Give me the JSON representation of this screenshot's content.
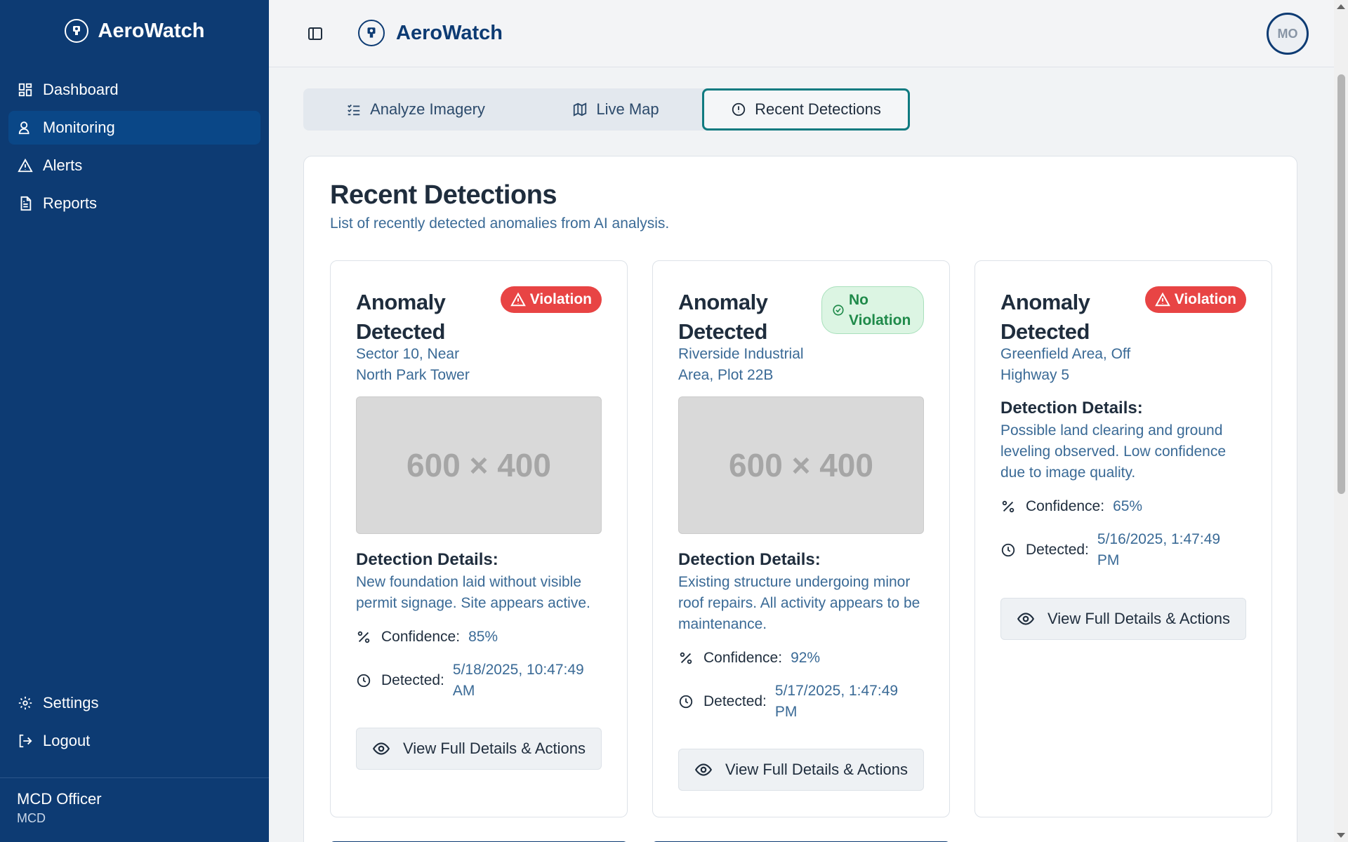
{
  "app": {
    "name": "AeroWatch"
  },
  "sidebar": {
    "brand": "AeroWatch",
    "items": [
      {
        "label": "Dashboard",
        "icon": "grid-icon"
      },
      {
        "label": "Monitoring",
        "icon": "user-search-icon",
        "active": true
      },
      {
        "label": "Alerts",
        "icon": "triangle-alert-icon"
      },
      {
        "label": "Reports",
        "icon": "file-text-icon"
      }
    ],
    "bottom_items": [
      {
        "label": "Settings",
        "icon": "gear-icon"
      },
      {
        "label": "Logout",
        "icon": "logout-icon"
      }
    ],
    "user": {
      "name": "MCD Officer",
      "org": "MCD"
    }
  },
  "header": {
    "brand": "AeroWatch",
    "avatar_initials": "MO"
  },
  "tabs": [
    {
      "label": "Analyze Imagery",
      "icon": "list-check-icon"
    },
    {
      "label": "Live Map",
      "icon": "map-icon"
    },
    {
      "label": "Recent Detections",
      "icon": "alert-circle-icon",
      "active": true
    }
  ],
  "panel": {
    "title": "Recent Detections",
    "subtitle": "List of recently detected anomalies from AI analysis."
  },
  "cards": [
    {
      "title": "Anomaly Detected",
      "status": "Violation",
      "location": "Sector 10, Near North Park Tower",
      "image_placeholder": "600 × 400",
      "details_title": "Detection Details:",
      "details": "New foundation laid without visible permit signage. Site appears active.",
      "confidence_label": "Confidence:",
      "confidence": "85%",
      "detected_label": "Detected:",
      "detected": "5/18/2025, 10:47:49 AM",
      "button": "View Full Details & Actions"
    },
    {
      "title": "Anomaly Detected",
      "status": "No Violation",
      "location": "Riverside Industrial Area, Plot 22B",
      "image_placeholder": "600 × 400",
      "details_title": "Detection Details:",
      "details": "Existing structure undergoing minor roof repairs. All activity appears to be maintenance.",
      "confidence_label": "Confidence:",
      "confidence": "92%",
      "detected_label": "Detected:",
      "detected": "5/17/2025, 1:47:49 PM",
      "button": "View Full Details & Actions"
    },
    {
      "title": "Anomaly Detected",
      "status": "Violation",
      "location": "Greenfield Area, Off Highway 5",
      "details_title": "Detection Details:",
      "details": "Possible land clearing and ground leveling observed. Low confidence due to image quality.",
      "confidence_label": "Confidence:",
      "confidence": "65%",
      "detected_label": "Detected:",
      "detected": "5/16/2025, 1:47:49 PM",
      "button": "View Full Details & Actions"
    }
  ],
  "colors": {
    "sidebar_bg": "#0d3b73",
    "accent_teal": "#0f7a80",
    "violation": "#e84444",
    "no_violation": "#1f8a4a",
    "muted_text": "#3a6a96"
  }
}
